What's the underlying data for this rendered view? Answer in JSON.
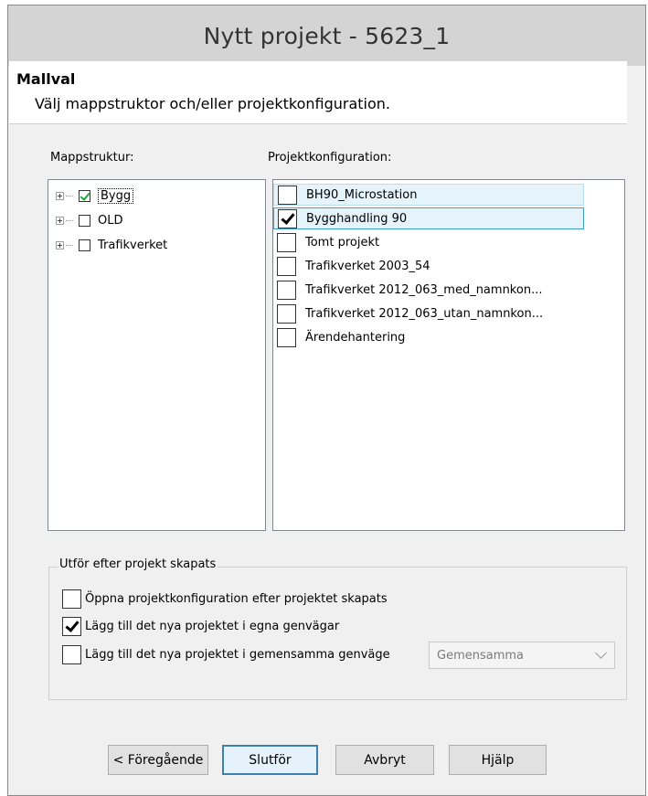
{
  "window": {
    "title": "Nytt projekt - 5623_1"
  },
  "header": {
    "title": "Mallval",
    "subtitle": "Välj mappstruktor och/eller projektkonfiguration."
  },
  "folder_structure": {
    "label": "Mappstruktur:",
    "items": [
      {
        "label": "Bygg",
        "checked": true
      },
      {
        "label": "OLD",
        "checked": false
      },
      {
        "label": "Trafikverket",
        "checked": false
      }
    ]
  },
  "project_config": {
    "label": "Projektkonfiguration:",
    "items": [
      {
        "label": "BH90_Microstation",
        "checked": false
      },
      {
        "label": "Bygghandling 90",
        "checked": true
      },
      {
        "label": "Tomt projekt",
        "checked": false
      },
      {
        "label": "Trafikverket 2003_54",
        "checked": false
      },
      {
        "label": "Trafikverket 2012_063_med_namnkon...",
        "checked": false
      },
      {
        "label": "Trafikverket 2012_063_utan_namnkon...",
        "checked": false
      },
      {
        "label": "Ärendehantering",
        "checked": false
      }
    ]
  },
  "after_create": {
    "title": "Utför efter projekt skapats",
    "options": [
      {
        "label": "Öppna projektkonfiguration efter projektet skapats",
        "checked": false
      },
      {
        "label": "Lägg till det nya projektet i egna genvägar",
        "checked": true
      },
      {
        "label": "Lägg till det nya projektet i gemensamma genväge",
        "checked": false
      }
    ],
    "shared_combo_value": "Gemensamma"
  },
  "buttons": {
    "back": "< Föregående",
    "finish": "Slutför",
    "cancel": "Avbryt",
    "help": "Hjälp"
  },
  "icons": {
    "expander": "plus-box-icon",
    "dropdown": "chevron-down-icon"
  }
}
